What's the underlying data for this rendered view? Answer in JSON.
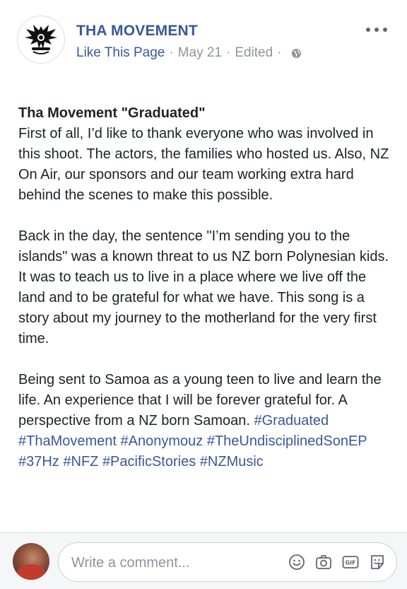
{
  "post": {
    "page_name": "THA MOVEMENT",
    "like_label": "Like This Page",
    "date": "May 21",
    "edited": "Edited",
    "title": "Tha Movement \"Graduated\"",
    "paragraph1": "First of all, I’d like to thank everyone who was involved in this shoot. The actors, the families who hosted us. Also, NZ On Air, our sponsors and our team working extra hard behind the scenes to make this possible.",
    "paragraph2": "Back in the day, the sentence \"I’m sending you to the islands\" was a known threat to us NZ born Polynesian kids. It was to teach us to live in a place where we live off the land and to be grateful for what we have. This song is a story about my journey to the motherland for the very first time.",
    "paragraph3": "Being sent to Samoa as a young teen to live and learn the life. An experience that I will be forever grateful for. A perspective from a NZ born Samoan.",
    "hashtags": [
      "#Graduated",
      "#ThaMovement",
      "#Anonymouz",
      "#TheUndisciplinedSonEP",
      "#37Hz",
      "#NFZ",
      "#PacificStories",
      "#NZMusic"
    ]
  },
  "comment": {
    "placeholder": "Write a comment..."
  },
  "icons": {
    "more": "more-options-icon",
    "privacy": "globe-icon",
    "emoji": "emoji-icon",
    "camera": "camera-icon",
    "gif": "gif-icon",
    "sticker": "sticker-icon"
  },
  "colors": {
    "link": "#385898",
    "text": "#1d2129",
    "meta": "#90949c"
  }
}
